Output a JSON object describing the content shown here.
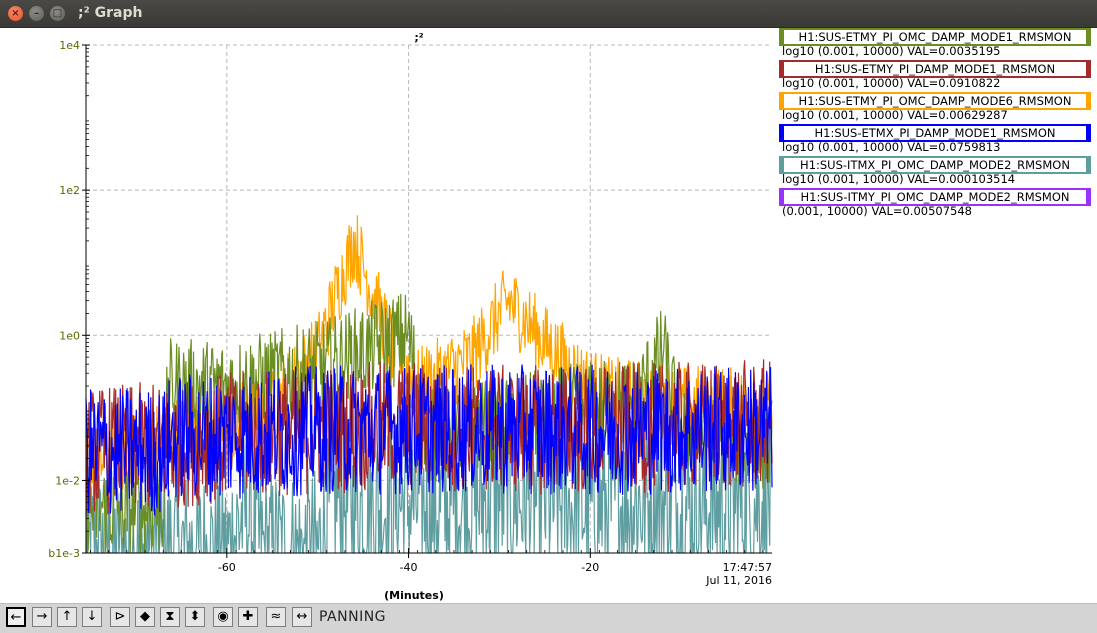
{
  "window": {
    "title": ";² Graph",
    "close_glyph": "×",
    "min_glyph": "–",
    "max_glyph": "□"
  },
  "chart_data": {
    "type": "line",
    "title": ";²",
    "xlabel": "(Minutes)",
    "ylabel": "",
    "ylog": true,
    "xlim": [
      -75.5,
      0
    ],
    "ylim": [
      0.001,
      10000
    ],
    "x_ticks": [
      "-60",
      "-40",
      "-20"
    ],
    "x_tick_values": [
      -60,
      -40,
      -20
    ],
    "y_ticks": [
      "1e4",
      "1e2",
      "1e0",
      "1e-2",
      "b1e-3"
    ],
    "y_tick_values": [
      10000,
      100,
      1,
      0.01,
      0.001
    ],
    "end_time": "17:47:57",
    "end_date": "Jul 11, 2016",
    "grid": true,
    "series": [
      {
        "name": "H1:SUS-ETMY_PI_OMC_DAMP_MODE1_RMSMON",
        "value_text": "log10 (0.001, 10000) VAL=0.0035195",
        "color": "#6b8e23",
        "base": [
          [
            -75.5,
            0.004
          ],
          [
            -67,
            0.004
          ],
          [
            -66.5,
            0.2
          ],
          [
            -60,
            0.2
          ],
          [
            -50,
            0.35
          ],
          [
            -40,
            1.0
          ],
          [
            -38,
            0.04
          ],
          [
            -30,
            0.06
          ],
          [
            -20,
            0.1
          ],
          [
            -15,
            0.12
          ],
          [
            -12,
            0.6
          ],
          [
            -10,
            0.05
          ],
          [
            0,
            0.03
          ]
        ],
        "spread": 0.22
      },
      {
        "name": "H1:SUS-ETMY_PI_DAMP_MODE1_RMSMON",
        "value_text": "log10 (0.001, 10000) VAL=0.0910822",
        "color": "#a52a2a",
        "base": [
          [
            -75.5,
            0.025
          ],
          [
            -67,
            0.03
          ],
          [
            -60,
            0.04
          ],
          [
            -50,
            0.05
          ],
          [
            -40,
            0.06
          ],
          [
            -30,
            0.05
          ],
          [
            -20,
            0.05
          ],
          [
            0,
            0.06
          ]
        ],
        "spread": 0.3
      },
      {
        "name": "H1:SUS-ETMY_PI_OMC_DAMP_MODE6_RMSMON",
        "value_text": "log10 (0.001, 10000) VAL=0.00629287",
        "color": "#ffa500",
        "base": [
          [
            -75.5,
            0.015
          ],
          [
            -67,
            0.04
          ],
          [
            -60,
            0.06
          ],
          [
            -55,
            0.1
          ],
          [
            -50,
            0.6
          ],
          [
            -46,
            20
          ],
          [
            -44,
            4
          ],
          [
            -42,
            0.8
          ],
          [
            -39,
            0.2
          ],
          [
            -36,
            0.3
          ],
          [
            -33,
            0.5
          ],
          [
            -29,
            3
          ],
          [
            -25,
            0.8
          ],
          [
            -21,
            0.25
          ],
          [
            -18,
            0.15
          ],
          [
            -10,
            0.12
          ],
          [
            0,
            0.1
          ]
        ],
        "spread": 0.18
      },
      {
        "name": "H1:SUS-ETMX_PI_DAMP_MODE1_RMSMON",
        "value_text": "log10 (0.001, 10000) VAL=0.0759813",
        "color": "#0000ff",
        "base": [
          [
            -75.5,
            0.025
          ],
          [
            -67,
            0.025
          ],
          [
            -66,
            0.04
          ],
          [
            -60,
            0.04
          ],
          [
            -50,
            0.05
          ],
          [
            -40,
            0.05
          ],
          [
            -30,
            0.05
          ],
          [
            -20,
            0.05
          ],
          [
            0,
            0.05
          ]
        ],
        "spread": 0.3
      },
      {
        "name": "H1:SUS-ITMX_PI_OMC_DAMP_MODE2_RMSMON",
        "value_text": "log10 (0.001, 10000) VAL=0.000103514",
        "color": "#5f9ea0",
        "base": [
          [
            -75.5,
            0.001
          ],
          [
            -62,
            0.001
          ],
          [
            -60,
            0.001
          ],
          [
            -58,
            0.004
          ],
          [
            -56,
            0.001
          ],
          [
            -50,
            0.001
          ],
          [
            -48,
            0.006
          ],
          [
            -45,
            0.004
          ],
          [
            -40,
            0.005
          ],
          [
            -36,
            0.004
          ],
          [
            -30,
            0.006
          ],
          [
            -25,
            0.005
          ],
          [
            -20,
            0.004
          ],
          [
            -15,
            0.005
          ],
          [
            -10,
            0.004
          ],
          [
            0,
            0.005
          ]
        ],
        "spread": 0.4
      },
      {
        "name": "H1:SUS-ITMY_PI_OMC_DAMP_MODE2_RMSMON",
        "value_text": "(0.001, 10000) VAL=0.00507548",
        "color": "#9b30ff",
        "base": [],
        "spread": 0
      }
    ]
  },
  "toolbar": {
    "status": "PANNING",
    "buttons": [
      {
        "name": "scroll-left-button",
        "glyph": "←"
      },
      {
        "name": "scroll-right-button",
        "glyph": "→"
      },
      {
        "name": "scroll-up-button",
        "glyph": "↑"
      },
      {
        "name": "scroll-down-button",
        "glyph": "↓"
      },
      {
        "name": "zoom-x-in-button",
        "glyph": "⊳"
      },
      {
        "name": "zoom-x-out-button",
        "glyph": "◆"
      },
      {
        "name": "zoom-y-in-button",
        "glyph": "⧗"
      },
      {
        "name": "zoom-y-out-button",
        "glyph": "⬍"
      },
      {
        "name": "reset-button",
        "glyph": "◉"
      },
      {
        "name": "add-button",
        "glyph": "✚"
      },
      {
        "name": "autoscale-button",
        "glyph": "≈"
      },
      {
        "name": "pan-mode-button",
        "glyph": "↔"
      }
    ]
  }
}
